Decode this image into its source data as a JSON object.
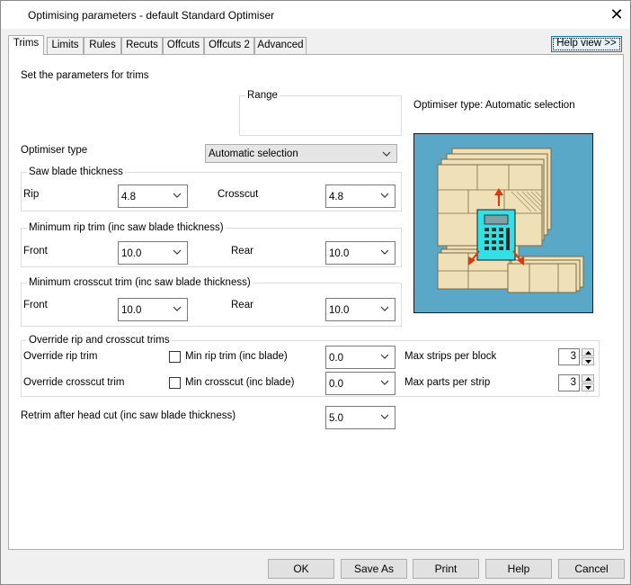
{
  "window": {
    "title": "Optimising parameters - default Standard Optimiser",
    "close_glyph": "✕"
  },
  "tabs": [
    "Trims",
    "Limits",
    "Rules",
    "Recuts",
    "Offcuts",
    "Offcuts 2",
    "Advanced"
  ],
  "help_view_label": "Help view >>",
  "intro_text": "Set the parameters for trims",
  "range_label": "Range",
  "optimiser_type_info": "Optimiser type: Automatic selection",
  "optimiser_type": {
    "label": "Optimiser type",
    "value": "Automatic selection"
  },
  "saw_blade": {
    "title": "Saw blade thickness",
    "rip_label": "Rip",
    "rip_value": "4.8",
    "crosscut_label": "Crosscut",
    "crosscut_value": "4.8"
  },
  "min_rip_trim": {
    "title": "Minimum rip trim (inc saw blade thickness)",
    "front_label": "Front",
    "front_value": "10.0",
    "rear_label": "Rear",
    "rear_value": "10.0"
  },
  "min_crosscut_trim": {
    "title": "Minimum crosscut trim (inc saw blade thickness)",
    "front_label": "Front",
    "front_value": "10.0",
    "rear_label": "Rear",
    "rear_value": "10.0"
  },
  "override": {
    "title": "Override rip and crosscut trims",
    "rip_label": "Override rip trim",
    "rip_check_label": "Min rip trim (inc blade)",
    "rip_value": "0.0",
    "crosscut_label": "Override crosscut trim",
    "crosscut_check_label": "Min crosscut (inc blade)",
    "crosscut_value": "0.0",
    "max_strips_label": "Max strips per block",
    "max_strips_value": "3",
    "max_parts_label": "Max parts per strip",
    "max_parts_value": "3"
  },
  "retrim": {
    "label": "Retrim after head cut (inc saw blade thickness)",
    "value": "5.0"
  },
  "buttons": {
    "ok": "OK",
    "save_as": "Save As",
    "print": "Print",
    "help": "Help",
    "cancel": "Cancel"
  },
  "colors": {
    "illustration_bg": "#5aa8c8",
    "board": "#efe0b8",
    "calculator": "#33e0e8",
    "arrow": "#d83a10",
    "accent": "#0078d7"
  }
}
